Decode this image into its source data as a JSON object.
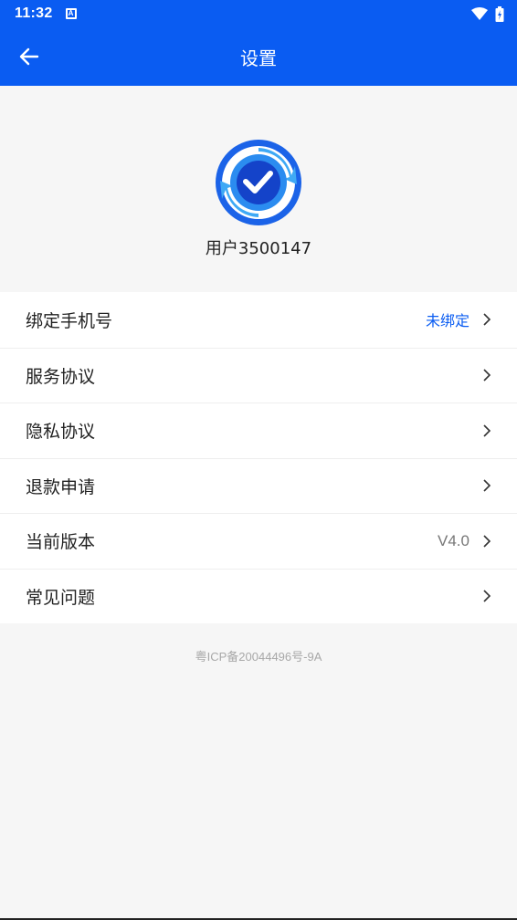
{
  "status_bar": {
    "time": "11:32",
    "notification_icon": "a-letter-icon",
    "wifi_icon": "wifi-icon",
    "battery_icon": "battery-charging-icon"
  },
  "app_bar": {
    "title": "设置",
    "back_icon": "arrow-left-icon",
    "background": "#0a5cf2"
  },
  "profile": {
    "avatar_icon": "shield-check-logo",
    "username": "用户3500147"
  },
  "menu": [
    {
      "label": "绑定手机号",
      "value": "未绑定",
      "value_color": "#0a5cf2"
    },
    {
      "label": "服务协议",
      "value": ""
    },
    {
      "label": "隐私协议",
      "value": ""
    },
    {
      "label": "退款申请",
      "value": ""
    },
    {
      "label": "当前版本",
      "value": "V4.0",
      "value_color": "#777777"
    },
    {
      "label": "常见问题",
      "value": ""
    }
  ],
  "footer": {
    "icp": "粤ICP备20044496号-9A"
  }
}
